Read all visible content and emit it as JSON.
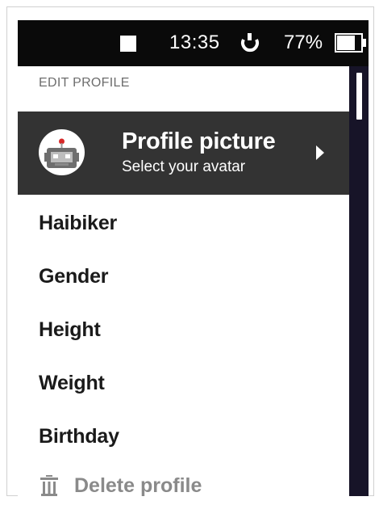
{
  "status_bar": {
    "time": "13:35",
    "battery_percent": "77%",
    "battery_level": 0.77,
    "icons": [
      "square-indicator-icon",
      "power-icon",
      "battery-icon"
    ]
  },
  "section": {
    "header": "EDIT PROFILE"
  },
  "profile_picture": {
    "title": "Profile picture",
    "subtitle": "Select your avatar",
    "icon": "robot-avatar-icon"
  },
  "menu": {
    "items": [
      {
        "label": "Haibiker"
      },
      {
        "label": "Gender"
      },
      {
        "label": "Height"
      },
      {
        "label": "Weight"
      },
      {
        "label": "Birthday"
      }
    ],
    "delete_label": "Delete profile"
  },
  "colors": {
    "status_bar_bg": "#0a0a0a",
    "selected_row_bg": "#333333",
    "scroll_rail_bg": "#171428",
    "text_primary": "#1a1a1a",
    "text_muted": "#8a8a8a"
  }
}
